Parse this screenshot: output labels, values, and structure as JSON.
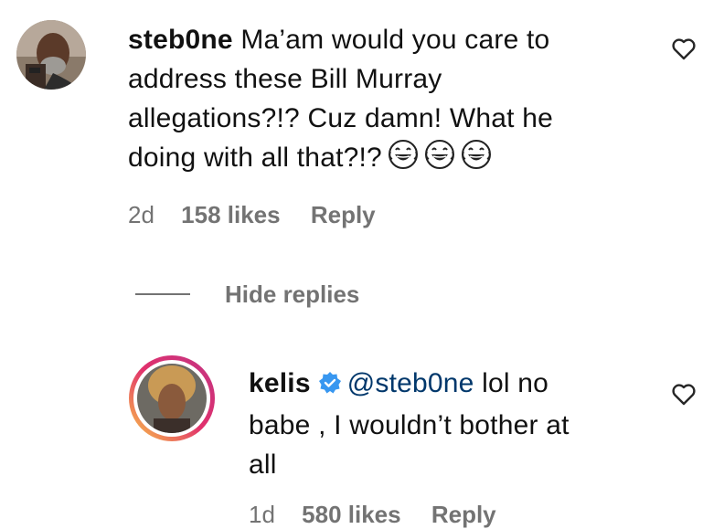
{
  "comment": {
    "username": "steb0ne",
    "text_lines": [
      " Ma’am would you care to",
      "address these Bill Murray",
      "allegations?!? Cuz damn! What he",
      "doing with all that?!?"
    ],
    "emoji_names": [
      "face-with-tears-of-joy-icon",
      "face-with-tears-of-joy-icon",
      "face-with-tears-of-joy-icon"
    ],
    "age": "2d",
    "likes": "158 likes",
    "reply_label": "Reply"
  },
  "hide_replies_label": "Hide replies",
  "reply": {
    "username": "kelis",
    "mention": "@steb0ne",
    "text_first": " lol no",
    "text_lines": [
      "babe , I wouldn’t bother at",
      "all"
    ],
    "age": "1d",
    "likes": "580 likes",
    "reply_label": "Reply"
  },
  "colors": {
    "meta_gray": "#737373",
    "mention_blue": "#00376b",
    "verified_blue": "#3897f0"
  }
}
